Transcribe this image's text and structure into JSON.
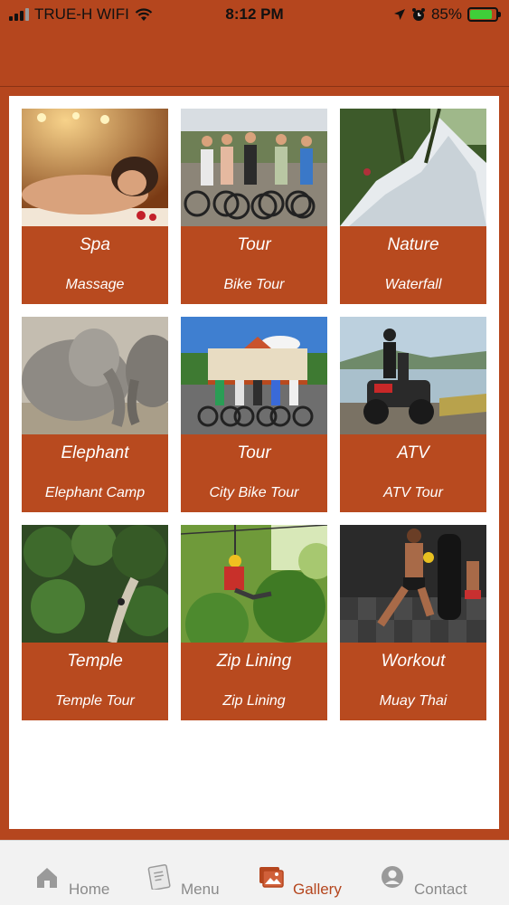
{
  "status_bar": {
    "carrier": "TRUE-H WIFI",
    "time": "8:12 PM",
    "battery": "85%"
  },
  "gallery": {
    "cards": [
      {
        "title": "Spa",
        "subtitle": "Massage"
      },
      {
        "title": "Tour",
        "subtitle": "Bike Tour"
      },
      {
        "title": "Nature",
        "subtitle": "Waterfall"
      },
      {
        "title": "Elephant",
        "subtitle": "Elephant Camp"
      },
      {
        "title": "Tour",
        "subtitle": "City Bike Tour"
      },
      {
        "title": "ATV",
        "subtitle": "ATV Tour"
      },
      {
        "title": "Temple",
        "subtitle": "Temple Tour"
      },
      {
        "title": "Zip Lining",
        "subtitle": "Zip Lining"
      },
      {
        "title": "Workout",
        "subtitle": "Muay Thai"
      }
    ]
  },
  "tab_bar": {
    "items": [
      {
        "label": "Home",
        "icon": "home-icon"
      },
      {
        "label": "Menu",
        "icon": "menu-icon"
      },
      {
        "label": "Gallery",
        "icon": "gallery-icon",
        "active": true
      },
      {
        "label": "Contact",
        "icon": "contact-icon"
      }
    ]
  },
  "colors": {
    "brand": "#b5461e",
    "card": "#b84a1f",
    "active_tab": "#b5461e",
    "inactive_tab": "#8a8a8a"
  }
}
